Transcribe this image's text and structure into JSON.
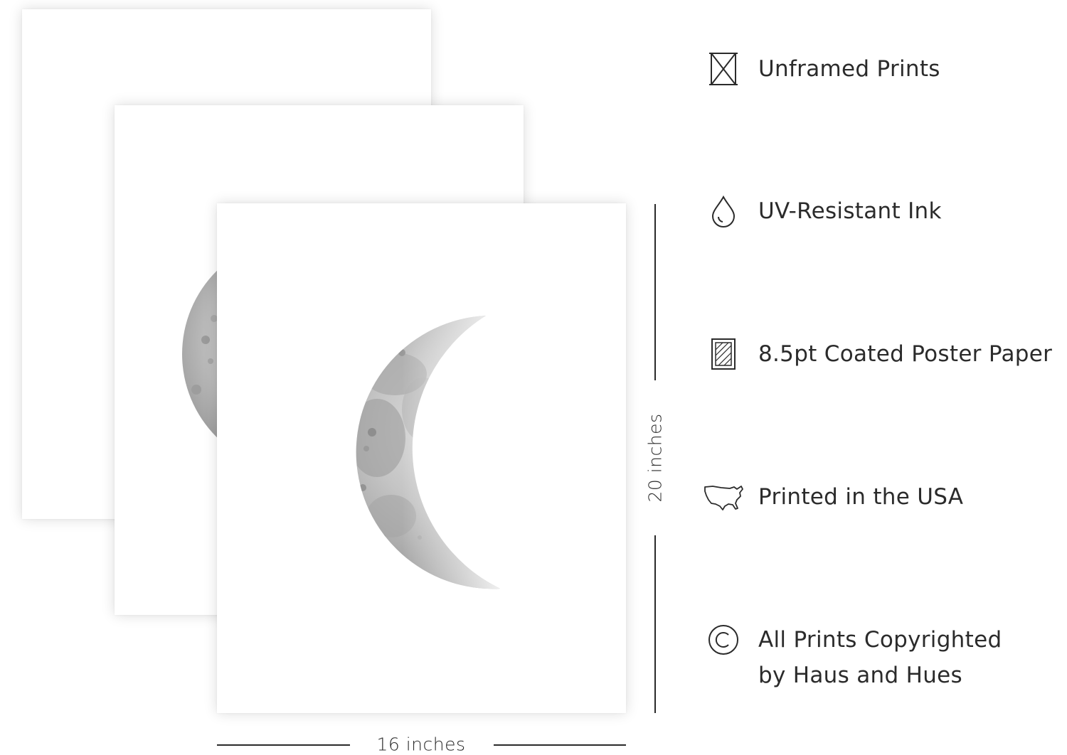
{
  "colors": {
    "background": "#ffffff",
    "text": "#2b2b2b",
    "moon_light": "#d6d6d6",
    "moon_dark": "#8f8f8f"
  },
  "dimensions": {
    "height_label": "20 inches",
    "width_label": "16 inches"
  },
  "features": [
    {
      "icon": "unframed-box-icon",
      "label": "Unframed Prints"
    },
    {
      "icon": "ink-drop-icon",
      "label": "UV-Resistant Ink"
    },
    {
      "icon": "paper-sheet-icon",
      "label": "8.5pt Coated Poster Paper"
    },
    {
      "icon": "usa-map-icon",
      "label": "Printed in the USA"
    },
    {
      "icon": "copyright-icon",
      "label_line1": "All Prints Copyrighted",
      "label_line2": "by Haus and Hues"
    }
  ]
}
